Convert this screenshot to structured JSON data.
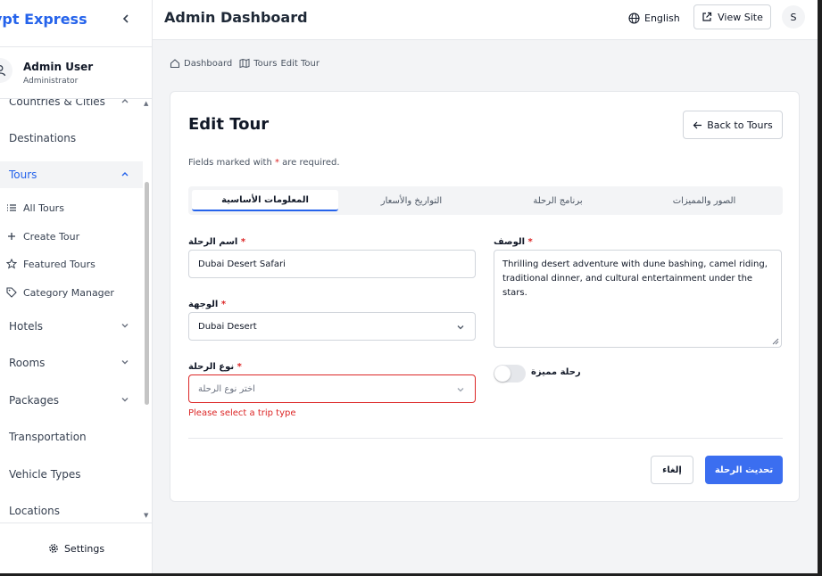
{
  "sidebar": {
    "brand": "ypt Express",
    "user": {
      "name": "Admin User",
      "role": "Administrator"
    },
    "items": [
      {
        "label": "Countries & Cities"
      },
      {
        "label": "Destinations"
      },
      {
        "label": "Tours"
      },
      {
        "label": "Hotels"
      },
      {
        "label": "Rooms"
      },
      {
        "label": "Packages"
      },
      {
        "label": "Transportation"
      },
      {
        "label": "Vehicle Types"
      },
      {
        "label": "Locations"
      }
    ],
    "tour_sub": [
      {
        "label": "All Tours",
        "icon": "list-icon"
      },
      {
        "label": "Create Tour",
        "icon": "plus-icon"
      },
      {
        "label": "Featured Tours",
        "icon": "star-icon"
      },
      {
        "label": "Category Manager",
        "icon": "tag-icon"
      }
    ],
    "settings": "Settings"
  },
  "header": {
    "title": "Admin Dashboard",
    "language": "English",
    "view_site": "View Site",
    "user_initial": "S"
  },
  "breadcrumb": {
    "home": "Dashboard",
    "section": "Tours",
    "current": "Edit Tour"
  },
  "form": {
    "title": "Edit Tour",
    "back_label": "Back to Tours",
    "required_pre": "Fields marked with ",
    "required_star": "*",
    "required_post": " are required.",
    "tabs": [
      "المعلومات الأساسية",
      "التواريخ والأسعار",
      "برنامج الرحلة",
      "الصور والمميزات"
    ],
    "active_tab": 0,
    "tour_name_label": "اسم الرحلة",
    "tour_name_value": "Dubai Desert Safari",
    "destination_label": "الوجهة",
    "destination_value": "Dubai Desert",
    "trip_type_label": "نوع الرحلة",
    "trip_type_placeholder": "اختر نوع الرحلة",
    "trip_type_error": "Please select a trip type",
    "description_label": "الوصف",
    "description_value": "Thrilling desert adventure with dune bashing, camel riding, traditional dinner, and cultural entertainment under the stars.",
    "featured_label": "رحلة مميزة",
    "featured_on": false,
    "cancel_label": "إلغاء",
    "update_label": "تحديث الرحلة"
  },
  "colors": {
    "accent": "#2563eb",
    "primary_button": "#3b6ef0",
    "error": "#dc2626"
  }
}
